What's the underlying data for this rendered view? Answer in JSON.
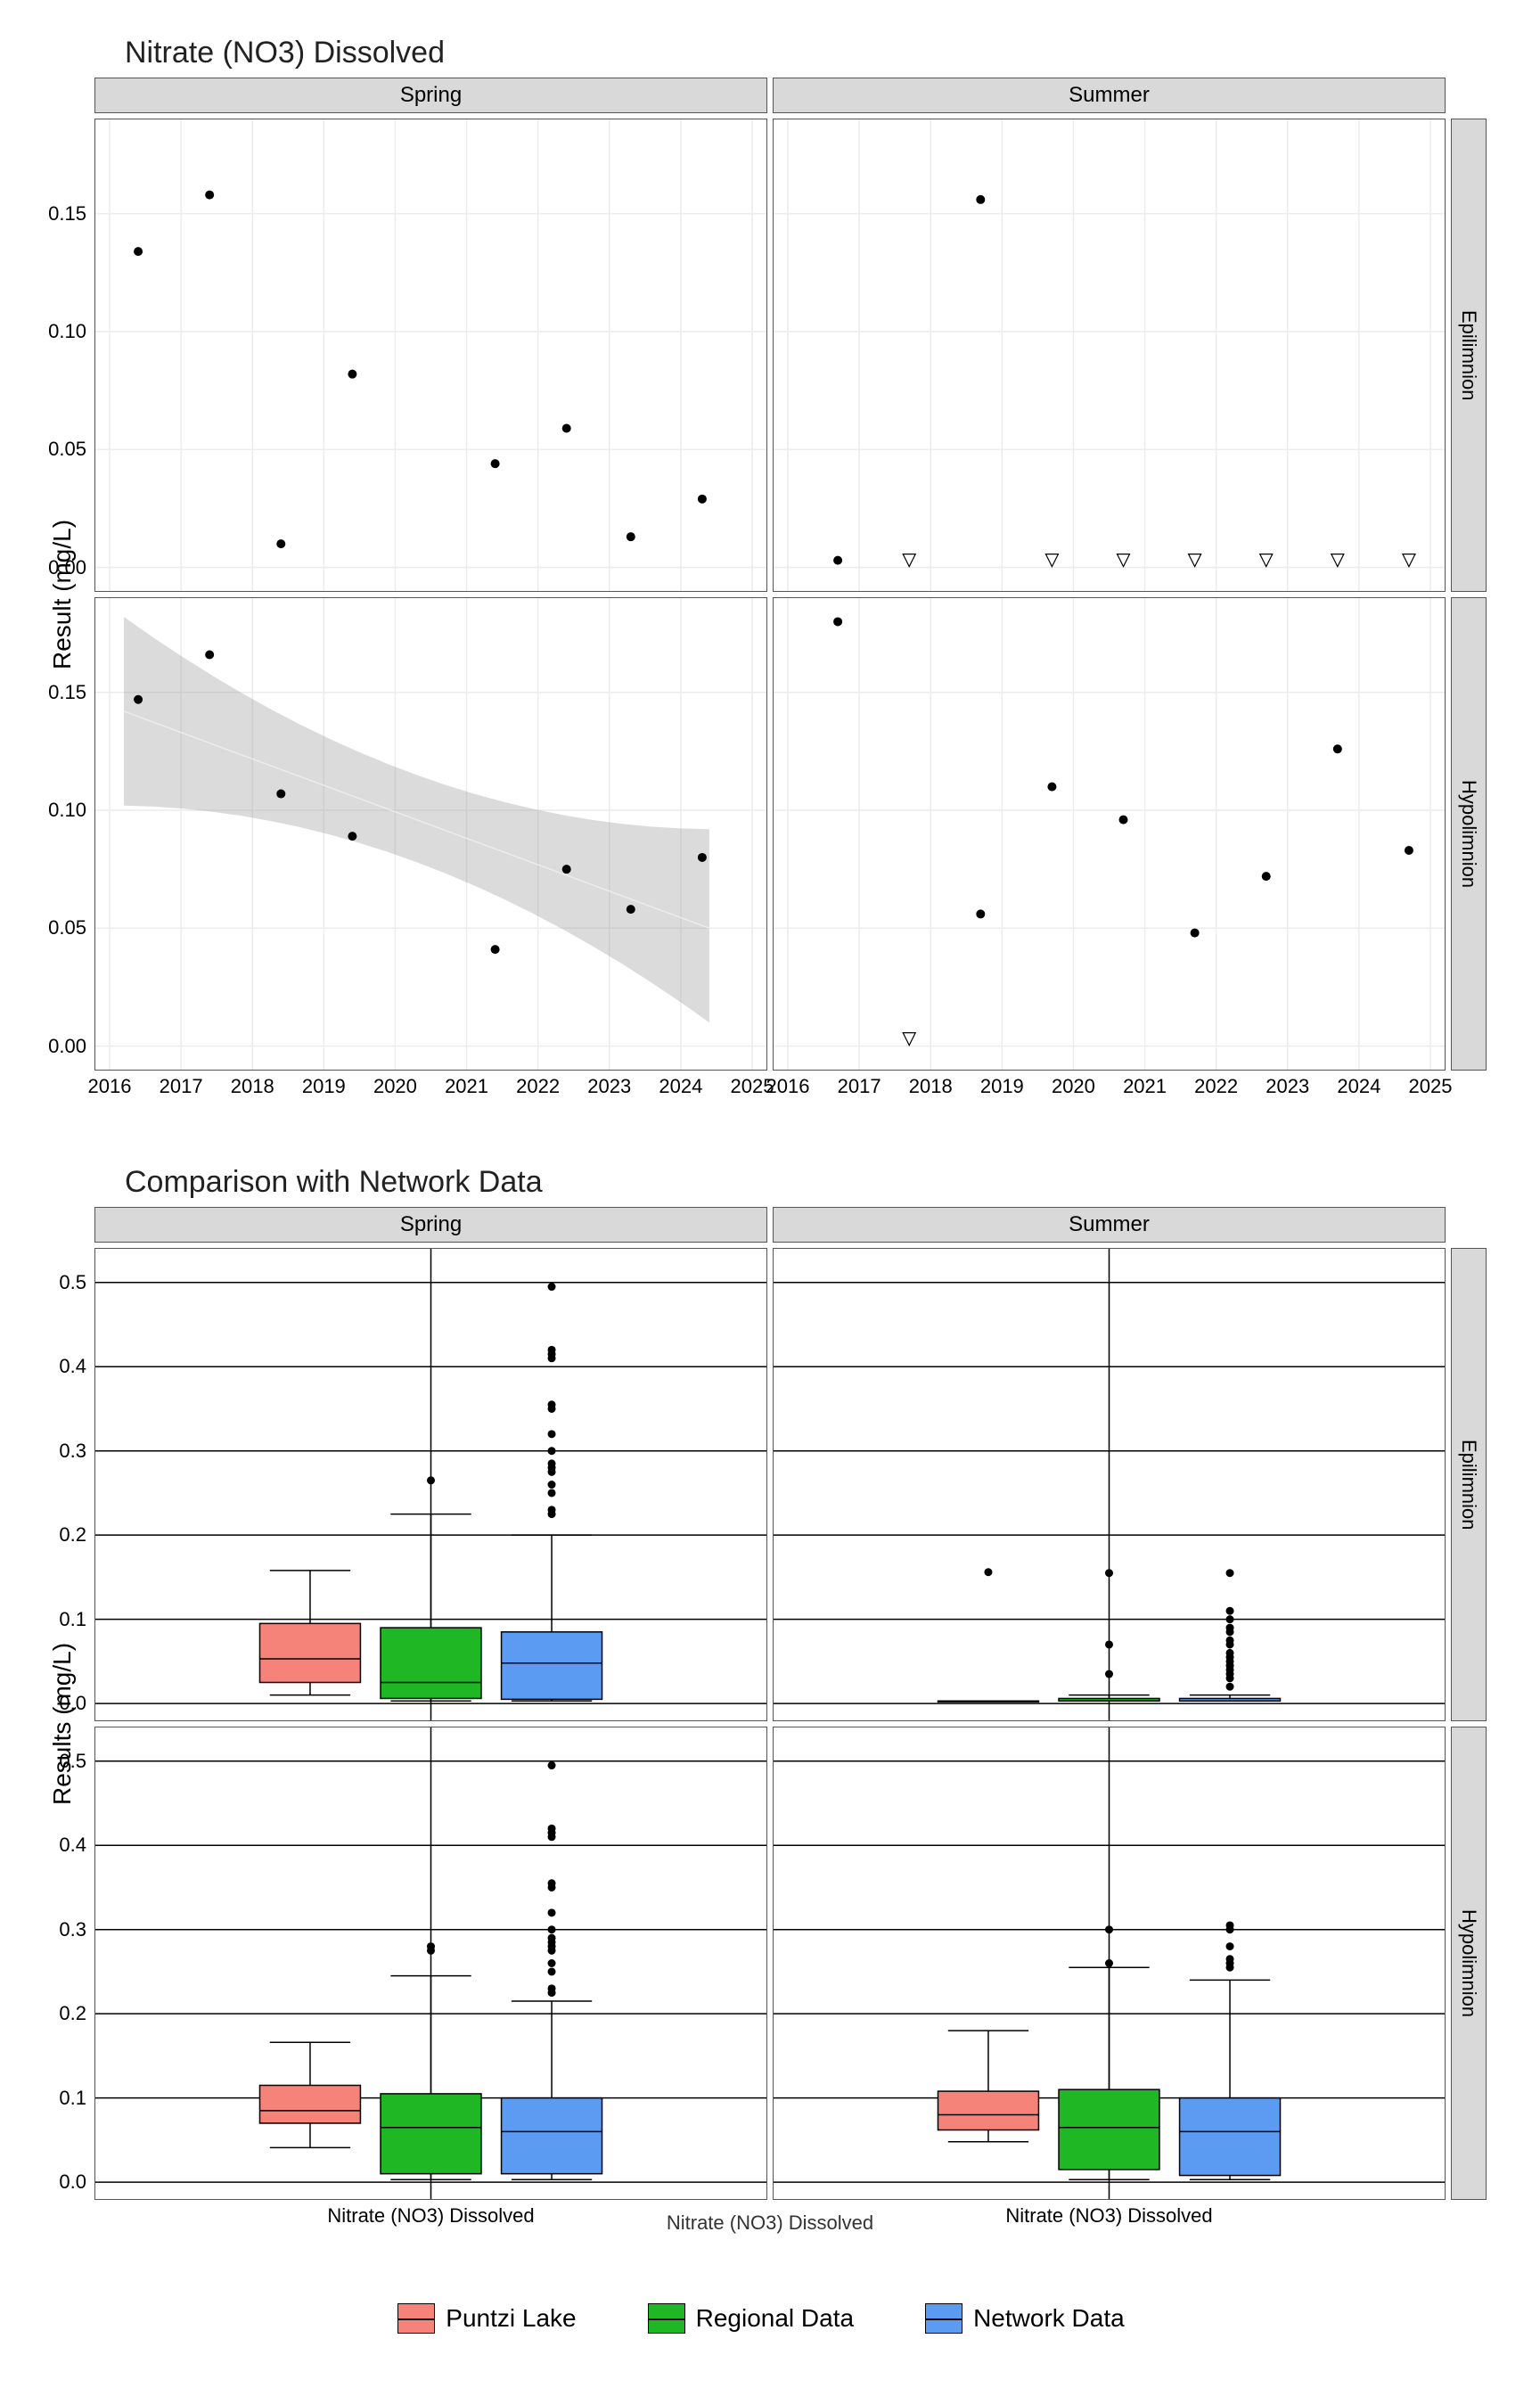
{
  "chart1": {
    "title": "Nitrate (NO3) Dissolved",
    "ylabel": "Result (mg/L)",
    "facets": {
      "cols": [
        "Spring",
        "Summer"
      ],
      "rows": [
        "Epilimnion",
        "Hypolimnion"
      ]
    },
    "x_ticks": [
      2016,
      2017,
      2018,
      2019,
      2020,
      2021,
      2022,
      2023,
      2024,
      2025
    ],
    "y_ticks": [
      0.0,
      0.05,
      0.1,
      0.15
    ],
    "x_range": [
      2015.8,
      2025.2
    ],
    "y_range": [
      -0.01,
      0.19
    ]
  },
  "chart2": {
    "title": "Comparison with Network Data",
    "ylabel": "Results (mg/L)",
    "facets": {
      "cols": [
        "Spring",
        "Summer"
      ],
      "rows": [
        "Epilimnion",
        "Hypolimnion"
      ]
    },
    "y_ticks": [
      0.0,
      0.1,
      0.2,
      0.3,
      0.4,
      0.5
    ],
    "y_range": [
      -0.02,
      0.54
    ],
    "xlabel": "Nitrate (NO3) Dissolved",
    "groups": [
      "Puntzi Lake",
      "Regional Data",
      "Network Data"
    ],
    "colors": {
      "Puntzi Lake": "#f6837a",
      "Regional Data": "#1fb724",
      "Network Data": "#5c9bf2"
    }
  },
  "legend": [
    {
      "label": "Puntzi Lake",
      "color": "#f6837a"
    },
    {
      "label": "Regional Data",
      "color": "#1fb724"
    },
    {
      "label": "Network Data",
      "color": "#5c9bf2"
    }
  ],
  "chart_data": [
    {
      "type": "scatter",
      "title": "Nitrate (NO3) Dissolved",
      "ylabel": "Result (mg/L)",
      "xlim": [
        2015.8,
        2025.2
      ],
      "ylim": [
        -0.01,
        0.19
      ],
      "panels": {
        "Spring|Epilimnion": {
          "points": [
            [
              2016.4,
              0.134
            ],
            [
              2017.4,
              0.158
            ],
            [
              2018.4,
              0.01
            ],
            [
              2019.4,
              0.082
            ],
            [
              2021.4,
              0.044
            ],
            [
              2022.4,
              0.059
            ],
            [
              2023.3,
              0.013
            ],
            [
              2024.3,
              0.029
            ]
          ]
        },
        "Summer|Epilimnion": {
          "points": [
            [
              2016.7,
              0.003
            ],
            [
              2018.7,
              0.156
            ]
          ],
          "censored": [
            [
              2017.7,
              0.003
            ],
            [
              2019.7,
              0.003
            ],
            [
              2020.7,
              0.003
            ],
            [
              2021.7,
              0.003
            ],
            [
              2022.7,
              0.003
            ],
            [
              2023.7,
              0.003
            ],
            [
              2024.7,
              0.003
            ]
          ]
        },
        "Spring|Hypolimnion": {
          "points": [
            [
              2016.4,
              0.147
            ],
            [
              2017.4,
              0.166
            ],
            [
              2018.4,
              0.107
            ],
            [
              2019.4,
              0.089
            ],
            [
              2021.4,
              0.041
            ],
            [
              2022.4,
              0.075
            ],
            [
              2023.3,
              0.058
            ],
            [
              2024.3,
              0.08
            ]
          ],
          "trend": {
            "x": [
              2016.2,
              2024.4
            ],
            "y": [
              0.142,
              0.05
            ]
          },
          "ci": {
            "x": [
              2016.2,
              2024.4
            ],
            "upper": [
              0.182,
              0.092
            ],
            "lower": [
              0.102,
              0.01
            ]
          }
        },
        "Summer|Hypolimnion": {
          "points": [
            [
              2016.7,
              0.18
            ],
            [
              2018.7,
              0.056
            ],
            [
              2019.7,
              0.11
            ],
            [
              2020.7,
              0.096
            ],
            [
              2021.7,
              0.048
            ],
            [
              2022.7,
              0.072
            ],
            [
              2023.7,
              0.126
            ],
            [
              2024.7,
              0.083
            ]
          ],
          "censored": [
            [
              2017.7,
              0.003
            ]
          ]
        }
      }
    },
    {
      "type": "boxplot",
      "title": "Comparison with Network Data",
      "ylabel": "Results (mg/L)",
      "xlabel": "Nitrate (NO3) Dissolved",
      "ylim": [
        -0.02,
        0.54
      ],
      "groups": [
        "Puntzi Lake",
        "Regional Data",
        "Network Data"
      ],
      "panels": {
        "Spring|Epilimnion": {
          "Puntzi Lake": {
            "min": 0.01,
            "q1": 0.025,
            "med": 0.053,
            "q3": 0.095,
            "max": 0.158,
            "out": []
          },
          "Regional Data": {
            "min": 0.003,
            "q1": 0.006,
            "med": 0.025,
            "q3": 0.09,
            "max": 0.225,
            "out": [
              0.265
            ]
          },
          "Network Data": {
            "min": 0.003,
            "q1": 0.005,
            "med": 0.048,
            "q3": 0.085,
            "max": 0.2,
            "out": [
              0.225,
              0.23,
              0.25,
              0.26,
              0.275,
              0.28,
              0.285,
              0.3,
              0.32,
              0.35,
              0.355,
              0.41,
              0.415,
              0.42,
              0.495
            ]
          }
        },
        "Summer|Epilimnion": {
          "Puntzi Lake": {
            "min": 0.003,
            "q1": 0.003,
            "med": 0.003,
            "q3": 0.003,
            "max": 0.003,
            "out": [
              0.156
            ]
          },
          "Regional Data": {
            "min": 0.003,
            "q1": 0.003,
            "med": 0.003,
            "q3": 0.006,
            "max": 0.01,
            "out": [
              0.035,
              0.07,
              0.155
            ]
          },
          "Network Data": {
            "min": 0.003,
            "q1": 0.003,
            "med": 0.003,
            "q3": 0.006,
            "max": 0.01,
            "out": [
              0.02,
              0.03,
              0.035,
              0.04,
              0.045,
              0.05,
              0.055,
              0.06,
              0.07,
              0.075,
              0.085,
              0.09,
              0.1,
              0.11,
              0.155
            ]
          }
        },
        "Spring|Hypolimnion": {
          "Puntzi Lake": {
            "min": 0.041,
            "q1": 0.07,
            "med": 0.085,
            "q3": 0.115,
            "max": 0.166,
            "out": []
          },
          "Regional Data": {
            "min": 0.003,
            "q1": 0.01,
            "med": 0.065,
            "q3": 0.105,
            "max": 0.245,
            "out": [
              0.275,
              0.28
            ]
          },
          "Network Data": {
            "min": 0.003,
            "q1": 0.01,
            "med": 0.06,
            "q3": 0.1,
            "max": 0.215,
            "out": [
              0.225,
              0.23,
              0.25,
              0.26,
              0.275,
              0.28,
              0.285,
              0.29,
              0.3,
              0.32,
              0.35,
              0.355,
              0.41,
              0.415,
              0.42,
              0.495
            ]
          }
        },
        "Summer|Hypolimnion": {
          "Puntzi Lake": {
            "min": 0.048,
            "q1": 0.062,
            "med": 0.08,
            "q3": 0.108,
            "max": 0.18,
            "out": []
          },
          "Regional Data": {
            "min": 0.003,
            "q1": 0.015,
            "med": 0.065,
            "q3": 0.11,
            "max": 0.255,
            "out": [
              0.26,
              0.3
            ]
          },
          "Network Data": {
            "min": 0.003,
            "q1": 0.008,
            "med": 0.06,
            "q3": 0.1,
            "max": 0.24,
            "out": [
              0.255,
              0.26,
              0.265,
              0.28,
              0.3,
              0.305
            ]
          }
        }
      }
    }
  ]
}
